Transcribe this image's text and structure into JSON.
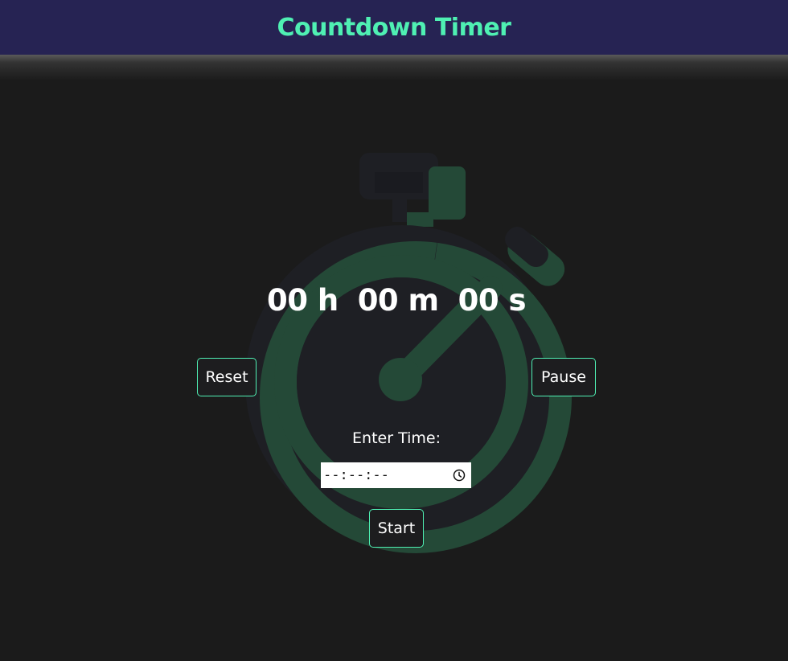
{
  "header": {
    "title": "Countdown Timer"
  },
  "timer": {
    "hours": "00 h",
    "minutes": "00 m",
    "seconds": "00 s"
  },
  "controls": {
    "reset_label": "Reset",
    "pause_label": "Pause",
    "start_label": "Start"
  },
  "time_entry": {
    "label": "Enter Time:",
    "value_placeholder": "--:--:--"
  },
  "colors": {
    "header_bg": "#262353",
    "accent": "#4ff0b3",
    "page_bg": "#1b1b1b",
    "stopwatch_dark": "#1e1f24",
    "stopwatch_green": "#244937"
  },
  "icons": [
    "stopwatch-icon",
    "clock-icon"
  ]
}
